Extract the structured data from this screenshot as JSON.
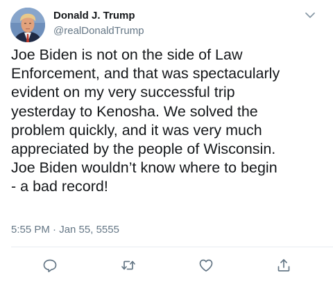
{
  "author": {
    "name": "Donald J. Trump",
    "handle": "@realDonaldTrump",
    "avatar": "profile-photo"
  },
  "tweet": {
    "text": "Joe Biden is not on the side of Law\nEnforcement, and that was spectacularly\nevident on my very successful trip\nyesterday to Kenosha. We solved the\nproblem quickly, and it was very much\nappreciated by the people of Wisconsin.\nJoe Biden wouldn’t know where to begin\n- a bad record!",
    "timestamp": "5:55 PM · Jan 55, 5555"
  },
  "icons": {
    "menu": "chevron-down-icon",
    "reply": "reply-icon",
    "retweet": "retweet-icon",
    "like": "heart-icon",
    "share": "share-icon"
  },
  "colors": {
    "text_primary": "#14171a",
    "text_secondary": "#657786",
    "icon_gray": "#657786",
    "divider": "#e6ecf0"
  }
}
